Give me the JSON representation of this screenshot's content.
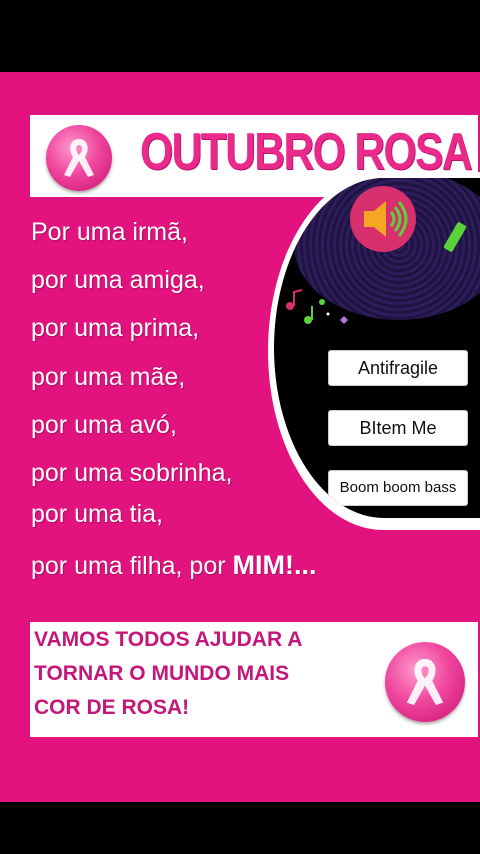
{
  "poster": {
    "title": "OUTUBRO ROSA",
    "lines": [
      "Por uma irmã,",
      "por uma amiga,",
      "por uma prima,",
      "por uma mãe,",
      "por uma avó,",
      "por uma sobrinha,",
      "por uma tia,"
    ],
    "last_line_prefix": "por uma filha, por ",
    "last_line_emphasis": "MIM!...",
    "footer_lines": [
      "VAMOS TODOS AJUDAR A",
      "TORNAR O MUNDO MAIS",
      "COR DE ROSA!"
    ]
  },
  "player": {
    "icon": "speaker-icon",
    "songs": [
      "Antifragile",
      "BItem Me",
      "Boom boom bass"
    ]
  },
  "colors": {
    "poster_bg": "#e2137f",
    "title_pink": "#ea2a8b",
    "footer_text": "#c4177a",
    "speaker_btn": "#d8306c"
  }
}
